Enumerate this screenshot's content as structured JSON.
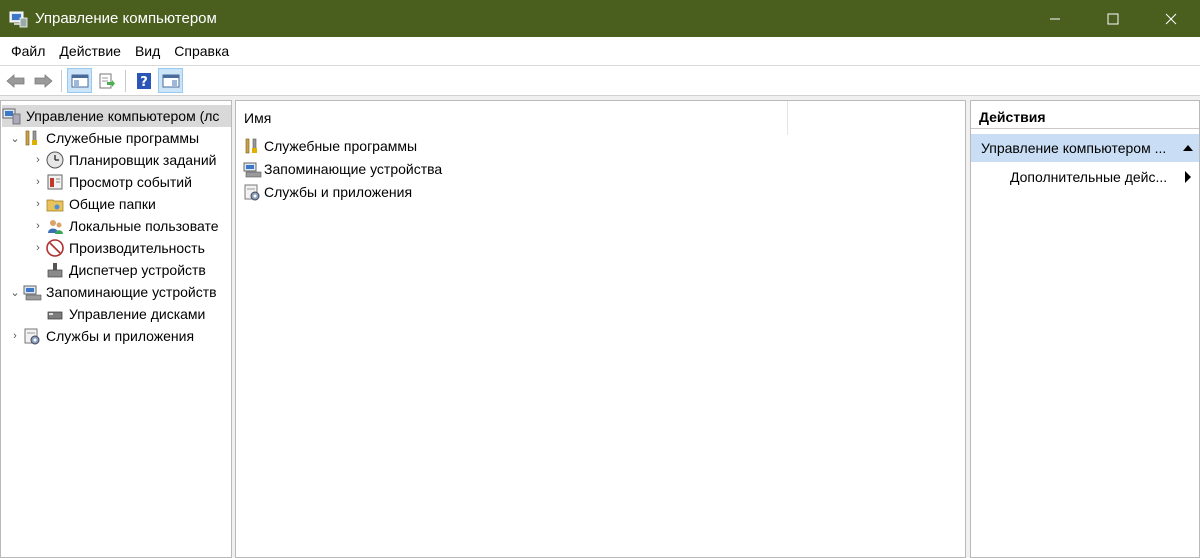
{
  "window": {
    "title": "Управление компьютером",
    "icon": "computer-management-icon"
  },
  "menu": [
    "Файл",
    "Действие",
    "Вид",
    "Справка"
  ],
  "toolbar": {
    "buttons": [
      "back-arrow-icon",
      "forward-arrow-icon",
      "show-hide-console-tree-icon",
      "export-list-icon",
      "help-icon",
      "show-hide-action-pane-icon"
    ]
  },
  "tree": {
    "root": "Управление компьютером (лс",
    "items": [
      {
        "label": "Служебные программы",
        "icon": "tools-icon"
      },
      {
        "label": "Планировщик заданий",
        "icon": "clock-icon"
      },
      {
        "label": "Просмотр событий",
        "icon": "event-viewer-icon"
      },
      {
        "label": "Общие папки",
        "icon": "shared-folders-icon"
      },
      {
        "label": "Локальные пользовате",
        "icon": "users-icon"
      },
      {
        "label": "Производительность",
        "icon": "performance-icon"
      },
      {
        "label": "Диспетчер устройств",
        "icon": "device-manager-icon"
      },
      {
        "label": "Запоминающие устройств",
        "icon": "storage-icon"
      },
      {
        "label": "Управление дисками",
        "icon": "disk-management-icon"
      },
      {
        "label": "Службы и приложения",
        "icon": "services-icon"
      }
    ]
  },
  "list": {
    "column_name": "Имя",
    "rows": [
      {
        "label": "Служебные программы",
        "icon": "tools-icon"
      },
      {
        "label": "Запоминающие устройства",
        "icon": "storage-icon"
      },
      {
        "label": "Службы и приложения",
        "icon": "services-icon"
      }
    ]
  },
  "actions": {
    "header": "Действия",
    "section": "Управление компьютером ...",
    "more": "Дополнительные дейс..."
  },
  "colors": {
    "titlebar": "#4a5e1e",
    "selection": "#c9def5"
  }
}
